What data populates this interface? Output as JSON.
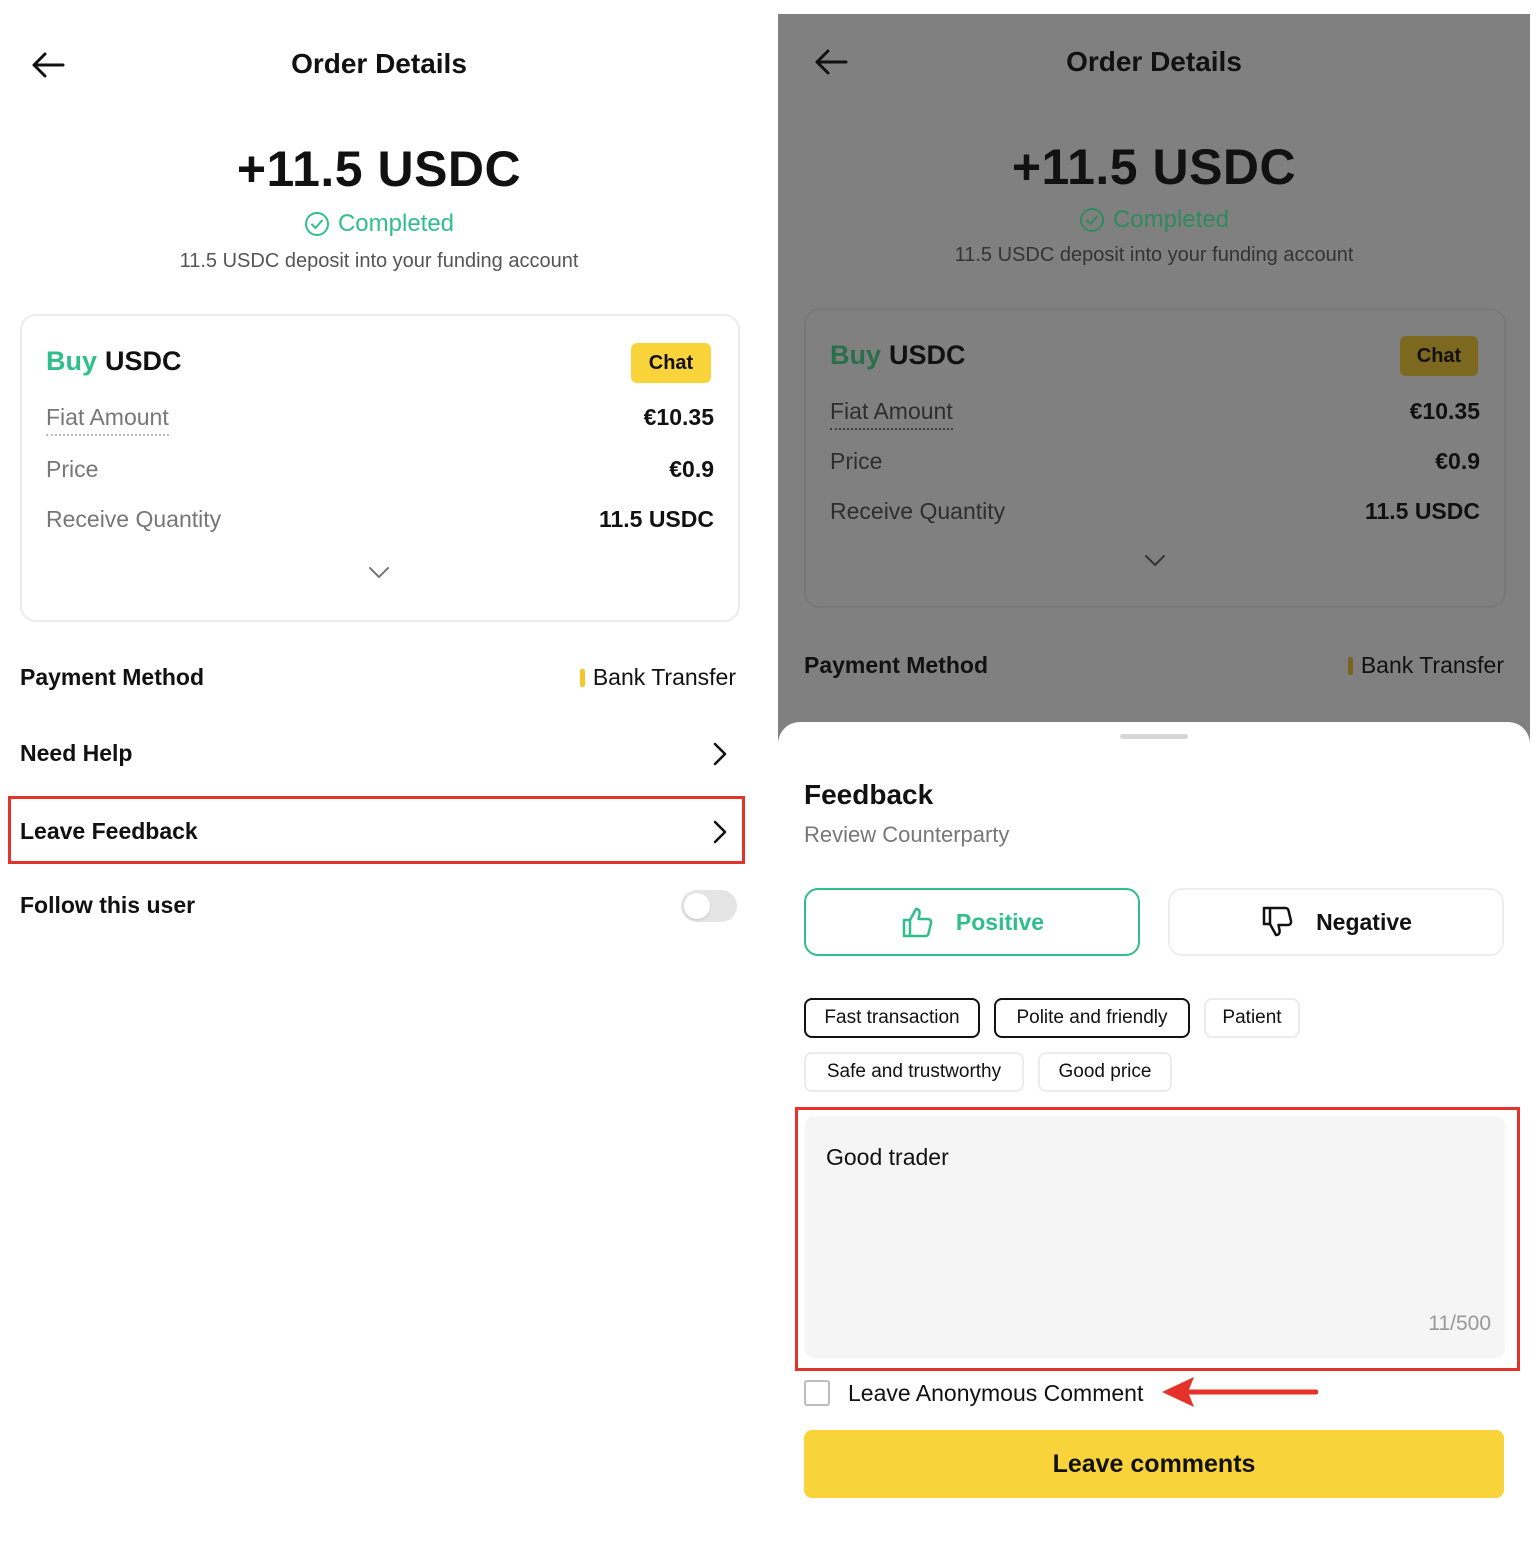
{
  "order": {
    "title": "Order Details",
    "amount": "+11.5 USDC",
    "status": "Completed",
    "subtitle": "11.5 USDC deposit into your funding account",
    "side": "Buy",
    "asset": "USDC",
    "chat_label": "Chat",
    "rows": [
      {
        "label": "Fiat Amount",
        "value": "€10.35"
      },
      {
        "label": "Price",
        "value": "€0.9"
      },
      {
        "label": "Receive Quantity",
        "value": "11.5 USDC"
      }
    ],
    "payment_method_label": "Payment Method",
    "payment_method_value": "Bank Transfer",
    "need_help_label": "Need Help",
    "leave_feedback_label": "Leave Feedback",
    "follow_label": "Follow this user"
  },
  "feedback": {
    "title": "Feedback",
    "subtitle": "Review Counterparty",
    "positive_label": "Positive",
    "negative_label": "Negative",
    "tags": [
      "Fast transaction",
      "Polite and friendly",
      "Patient",
      "Safe and trustworthy",
      "Good price"
    ],
    "comment": "Good trader",
    "counter": "11/500",
    "anonymous_label": "Leave Anonymous Comment",
    "submit_label": "Leave comments"
  },
  "colors": {
    "accent_green": "#2fbf8a",
    "accent_yellow": "#f8d33a",
    "highlight_red": "#e5332a",
    "overlay_gray": "#808080"
  },
  "icons": {
    "back": "arrow-left-icon",
    "status": "check-circle-icon",
    "expand": "chevron-down-icon",
    "row_nav": "chevron-right-icon",
    "positive": "thumbs-up-icon",
    "negative": "thumbs-down-icon",
    "annotation": "red-arrow-icon"
  },
  "states": {
    "follow_toggle_on": false,
    "positive_selected": true,
    "anonymous_checked": false,
    "selected_tags": [
      "Fast transaction",
      "Polite and friendly"
    ]
  }
}
